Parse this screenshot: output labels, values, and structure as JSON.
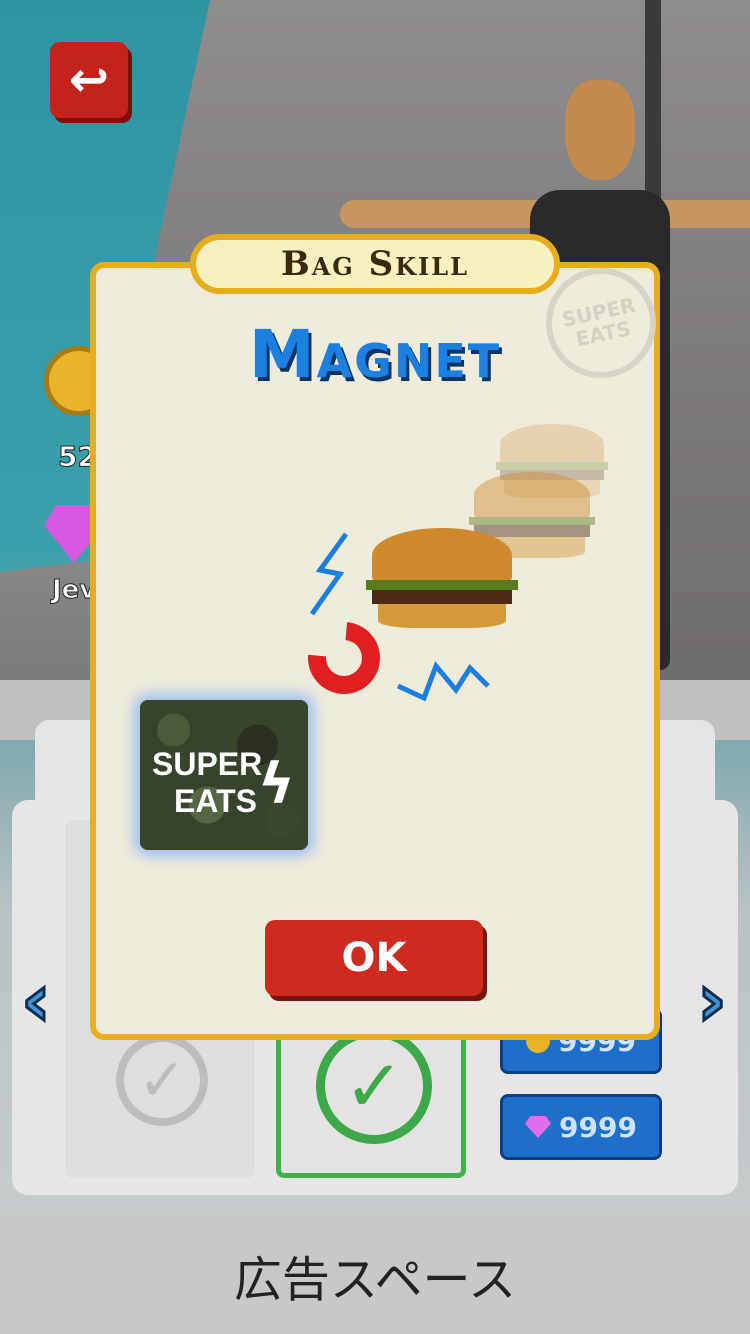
{
  "header": {
    "back_icon": "return-arrow-icon"
  },
  "currency": {
    "coins": "52",
    "jewels_label": "Jev"
  },
  "shop": {
    "price_coin": "9999",
    "price_gem": "9999"
  },
  "dialog": {
    "tab_title": "Bag Skill",
    "skill_name": "Magnet",
    "stamp_text": "SUPER EATS",
    "box_label_line1": "SUPER",
    "box_label_line2": "EATS",
    "ok_label": "OK"
  },
  "ad": {
    "text": "広告スペース"
  },
  "colors": {
    "accent_red": "#cf2a1f",
    "title_blue": "#1d7fe0",
    "frame_gold": "#e8ad1c",
    "selected_green": "#3da848"
  }
}
